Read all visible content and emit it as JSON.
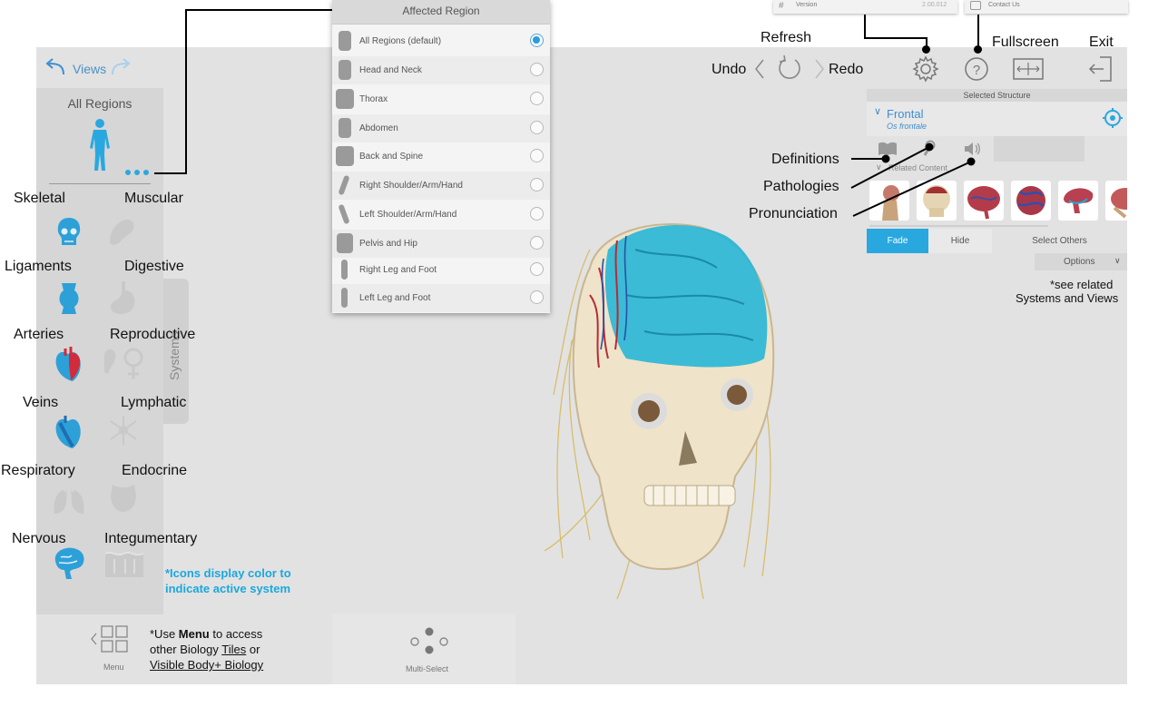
{
  "toolbar": {
    "views_label": "Views",
    "undo_label": "Undo",
    "redo_label": "Redo",
    "refresh_label": "Refresh",
    "fullscreen_label": "Fullscreen",
    "exit_label": "Exit"
  },
  "top_menu": {
    "version_label": "Version",
    "version_value": "2.00.012",
    "contact_label": "Contact Us"
  },
  "sidebar": {
    "region_title": "All Regions",
    "systems_tab": "Systems",
    "systems": [
      {
        "label": "Skeletal",
        "icon": "skull-icon",
        "active": true
      },
      {
        "label": "Muscular",
        "icon": "muscle-icon",
        "active": false
      },
      {
        "label": "Ligaments",
        "icon": "ligament-icon",
        "active": true
      },
      {
        "label": "Digestive",
        "icon": "stomach-icon",
        "active": false
      },
      {
        "label": "Arteries",
        "icon": "heart-artery-icon",
        "active": true
      },
      {
        "label": "Reproductive",
        "icon": "reproductive-icon",
        "active": false
      },
      {
        "label": "Veins",
        "icon": "heart-vein-icon",
        "active": true
      },
      {
        "label": "Lymphatic",
        "icon": "lymphatic-icon",
        "active": false
      },
      {
        "label": "Respiratory",
        "icon": "lungs-icon",
        "active": false
      },
      {
        "label": "Endocrine",
        "icon": "endocrine-icon",
        "active": false
      },
      {
        "label": "Nervous",
        "icon": "brain-icon",
        "active": true
      },
      {
        "label": "Integumentary",
        "icon": "skin-icon",
        "active": false
      }
    ],
    "note": "*Icons display color to indicate active system"
  },
  "region_panel": {
    "title": "Affected Region",
    "items": [
      {
        "label": "All Regions (default)",
        "selected": true
      },
      {
        "label": "Head and Neck",
        "selected": false
      },
      {
        "label": "Thorax",
        "selected": false
      },
      {
        "label": "Abdomen",
        "selected": false
      },
      {
        "label": "Back and Spine",
        "selected": false
      },
      {
        "label": "Right Shoulder/Arm/Hand",
        "selected": false
      },
      {
        "label": "Left Shoulder/Arm/Hand",
        "selected": false
      },
      {
        "label": "Pelvis and Hip",
        "selected": false
      },
      {
        "label": "Right Leg and Foot",
        "selected": false
      },
      {
        "label": "Left Leg and Foot",
        "selected": false
      }
    ]
  },
  "structure_panel": {
    "header": "Selected Structure",
    "name": "Frontal",
    "latin": "Os frontale",
    "related_label": "Related Content",
    "fade_label": "Fade",
    "hide_label": "Hide",
    "select_others_label": "Select Others",
    "options_label": "Options"
  },
  "callouts": {
    "definitions": "Definitions",
    "pathologies": "Pathologies",
    "pronunciation": "Pronunciation",
    "related_note_line1": "*see related",
    "related_note_line2": "Systems and Views"
  },
  "bottom": {
    "menu_label": "Menu",
    "menu_note_prefix": "*Use ",
    "menu_note_bold": "Menu",
    "menu_note_mid": " to access",
    "menu_note_line2_prefix": "other Biology ",
    "menu_note_tiles": "Tiles",
    "menu_note_or": " or",
    "menu_note_vbb": "Visible Body+ Biology",
    "multiselect_label": "Multi-Select"
  },
  "colors": {
    "accent_blue": "#29a8df",
    "panel_bg": "#e2e2e2",
    "link_blue": "#4a90c8",
    "note_blue": "#1ba7de"
  }
}
